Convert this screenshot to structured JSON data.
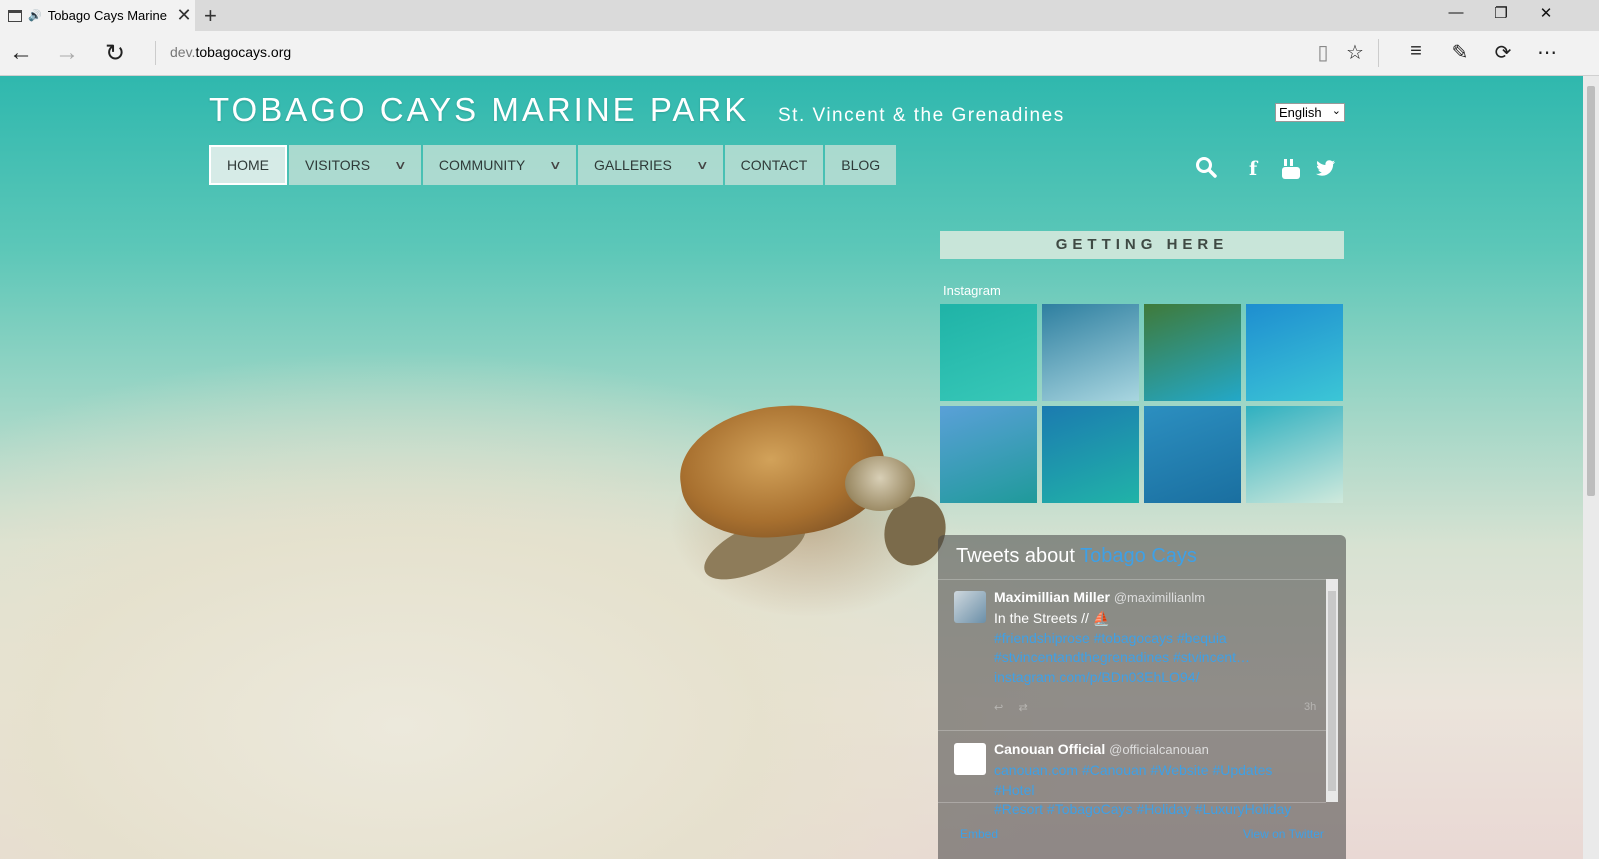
{
  "browser": {
    "tab_title": "Tobago Cays Marine",
    "new_tab": "+",
    "url_dim": "dev.",
    "url_main": "tobagocays.org"
  },
  "header": {
    "title": "TOBAGO CAYS MARINE PARK",
    "subtitle": "St. Vincent & the Grenadines",
    "language": "English"
  },
  "nav": {
    "items": [
      {
        "label": "HOME",
        "active": true,
        "dropdown": false
      },
      {
        "label": "VISITORS",
        "active": false,
        "dropdown": true
      },
      {
        "label": "COMMUNITY",
        "active": false,
        "dropdown": true
      },
      {
        "label": "GALLERIES",
        "active": false,
        "dropdown": true
      },
      {
        "label": "CONTACT",
        "active": false,
        "dropdown": false
      },
      {
        "label": "BLOG",
        "active": false,
        "dropdown": false
      }
    ]
  },
  "social": [
    "search-icon",
    "facebook-icon",
    "youtube-icon",
    "twitter-icon"
  ],
  "sidebar": {
    "getting_here": "GETTING HERE",
    "instagram_label": "Instagram",
    "instagram_photos": [
      {
        "colors": [
          "#1fb3a7",
          "#38c8b8"
        ]
      },
      {
        "colors": [
          "#2e7fa0",
          "#a9d6e0"
        ]
      },
      {
        "colors": [
          "#3f7a3a",
          "#23a8c8"
        ]
      },
      {
        "colors": [
          "#1e8ed0",
          "#3cc6d6"
        ]
      },
      {
        "colors": [
          "#5aa0d8",
          "#1f9a9a"
        ]
      },
      {
        "colors": [
          "#1b7bb0",
          "#21b3a8"
        ]
      },
      {
        "colors": [
          "#2c8fc0",
          "#1a6fa0"
        ]
      },
      {
        "colors": [
          "#2fb0c0",
          "#cfe9dc"
        ]
      }
    ]
  },
  "twitter": {
    "header_prefix": "Tweets about ",
    "header_link": "Tobago Cays",
    "tweets": [
      {
        "name": "Maximillian Miller",
        "handle": "@maximillianlm",
        "text": "In the Streets // ⛵",
        "tags_line1": "#friendshiprose #tobagocays #bequia",
        "tags_line2": "#stvincentandthegrenadines #stvincent…",
        "link": "instagram.com/p/BDn03EhLO94/",
        "time": "3h",
        "avatar_color": "#6b8fa8"
      },
      {
        "name": "Canouan Official",
        "handle": "@officialcanouan",
        "tags_line1": "canouan.com #Canouan #Website #Updates #Hotel",
        "tags_line2": "#Resort #TobagoCays #Holiday #LuxuryHoliday",
        "avatar_color": "#ffffff"
      }
    ],
    "footer_embed": "Embed",
    "footer_view": "View on Twitter"
  },
  "colors": {
    "tweet_link": "#3ea0e6",
    "nav_bg": "#c8e1d7"
  }
}
